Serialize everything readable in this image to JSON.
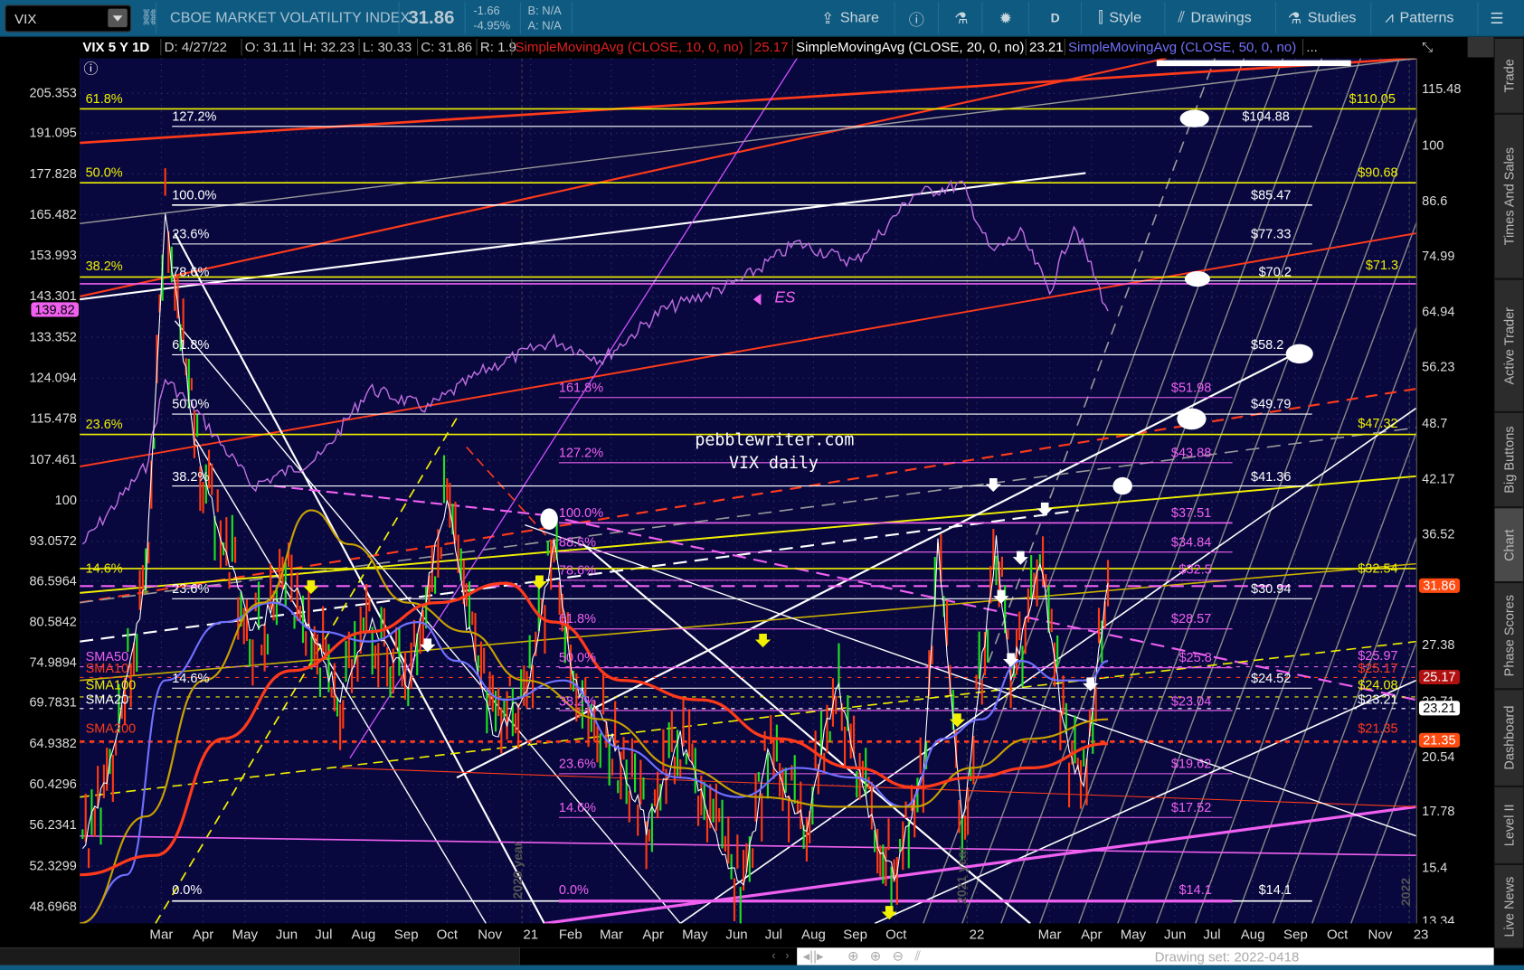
{
  "toolbar": {
    "symbol": "VIX",
    "description": "CBOE MARKET VOLATILITY INDEX",
    "last": "31.86",
    "change": "-1.66",
    "change_pct": "-4.95%",
    "bid": "B: N/A",
    "ask": "A: N/A",
    "share": "Share",
    "aggregation": "D",
    "style": "Style",
    "drawings": "Drawings",
    "studies": "Studies",
    "patterns": "Patterns"
  },
  "legend": {
    "title": "VIX 5 Y 1D",
    "date": "D: 4/27/22",
    "open": "O: 31.11",
    "high": "H: 32.23",
    "low": "L: 30.33",
    "close": "C: 31.86",
    "range": "R: 1.9",
    "sma10": "SimpleMovingAvg (CLOSE, 10, 0, no)",
    "sma10_val": "25.17",
    "sma20": "SimpleMovingAvg (CLOSE, 20, 0, no)",
    "sma20_val": "23.21",
    "sma50": "SimpleMovingAvg (CLOSE, 50, 0, no)",
    "more": "..."
  },
  "left_axis": [
    "205.353",
    "191.095",
    "177.828",
    "165.482",
    "153.993",
    "143.301",
    "133.352",
    "124.094",
    "115.478",
    "107.461",
    "100",
    "93.0572",
    "86.5964",
    "80.5842",
    "74.9894",
    "69.7831",
    "64.9382",
    "60.4296",
    "56.2341",
    "52.3299",
    "48.6968"
  ],
  "left_badge": "139.82",
  "right_axis": [
    "115.48",
    "100",
    "86.6",
    "74.99",
    "64.94",
    "56.23",
    "48.7",
    "42.17",
    "36.52",
    "27.38",
    "22.71",
    "20.54",
    "17.78",
    "15.4",
    "13.34"
  ],
  "right_badges": [
    {
      "text": "31.86",
      "color": "#ff4a10"
    },
    {
      "text": "25.17",
      "color": "#b01010"
    },
    {
      "text": "23.21",
      "color": "#ffffff"
    },
    {
      "text": "21.35",
      "color": "#ff4a10"
    }
  ],
  "x_axis": [
    "Mar",
    "Apr",
    "May",
    "Jun",
    "Jul",
    "Aug",
    "Sep",
    "Oct",
    "Nov",
    "21",
    "Feb",
    "Mar",
    "Apr",
    "May",
    "Jun",
    "Jul",
    "Aug",
    "Sep",
    "Oct",
    "22",
    "Mar",
    "Apr",
    "May",
    "Jun",
    "Jul",
    "Aug",
    "Sep",
    "Oct",
    "Nov",
    "23"
  ],
  "year_marks": [
    "2020 year",
    "2021 year",
    "2022 year"
  ],
  "chart_labels": [
    "61.8%",
    "127.2%",
    "50.0%",
    "100.0%",
    "23.6%",
    "78.6%",
    "38.2%",
    "61.8%",
    "50.0%",
    "23.6%",
    "38.2%",
    "14.6%",
    "23.6%",
    "14.6%",
    "0.0%",
    "161.8%",
    "127.2%",
    "100.0%",
    "88.6%",
    "78.6%",
    "61.8%",
    "50.0%",
    "38.2%",
    "23.6%",
    "14.6%",
    "0.0%",
    "$104.88",
    "$85.47",
    "$77.33",
    "$70.2",
    "$58.2",
    "$49.79",
    "$41.36",
    "$30.94",
    "$24.52",
    "$14.1",
    "$51.98",
    "$43.88",
    "$37.51",
    "$34.84",
    "$32.5",
    "$28.57",
    "$25.8",
    "$23.04",
    "$19.62",
    "$17.52",
    "$14.1",
    "$110.05",
    "$90.68",
    "$71.3",
    "$47.32",
    "$32.54",
    "$25.97",
    "$25.17",
    "$24.08",
    "$23.21",
    "$21.35",
    "SMA50",
    "SMA10",
    "SMA100",
    "SMA20",
    "SMA200"
  ],
  "watermark": {
    "site": "pebblewriter.com",
    "subtitle": "VIX daily",
    "es_label": "ES"
  },
  "side_tabs": [
    "Trade",
    "Times And Sales",
    "Active Trader",
    "Big Buttons",
    "Chart",
    "Phase Scores",
    "Dashboard",
    "Level II",
    "Live News"
  ],
  "active_tab": "Chart",
  "bottom": {
    "drawing_set": "Drawing set: 2022-0418"
  },
  "colors": {
    "background": "#08083f",
    "toolbar": "#0f5a80",
    "fib_yellow": "#f0f000",
    "fib_pink": "#f060f0",
    "sma10": "#ff3a1a",
    "sma50": "#7070ff"
  }
}
